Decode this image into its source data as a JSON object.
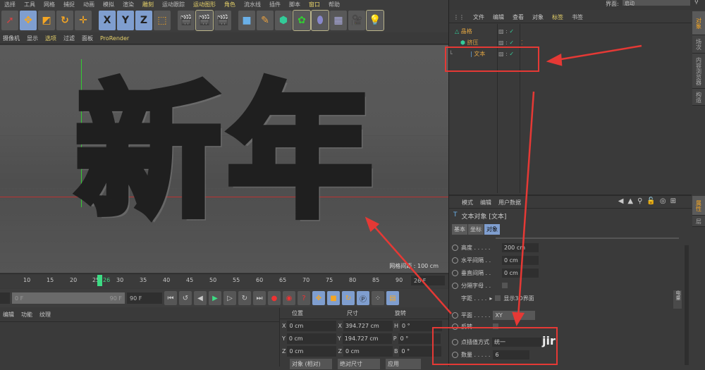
{
  "menubar": [
    "选择",
    "工具",
    "网格",
    "捕捉",
    "动画",
    "模拟",
    "渲染",
    "雕刻",
    "运动跟踪",
    "运动图形",
    "角色",
    "流水线",
    "插件",
    "脚本",
    "窗口",
    "帮助"
  ],
  "viewport_menu": [
    "摄像机",
    "显示",
    "选项",
    "过滤",
    "面板",
    "ProRender"
  ],
  "viewport": {
    "text": "新年",
    "grid_spacing": "网格间距 : 100 cm"
  },
  "timeline": {
    "ticks": [
      "10",
      "15",
      "20",
      "25",
      "26",
      "30",
      "35",
      "40",
      "45",
      "50",
      "55",
      "60",
      "65",
      "70",
      "75",
      "80",
      "85",
      "90"
    ],
    "current_frame": "26 F",
    "range_start": "0 F",
    "range_end": "90 F",
    "end_field": "90 F",
    "start_field": "0 F"
  },
  "material_menu": [
    "编辑",
    "功能",
    "纹理"
  ],
  "coordinates": {
    "headers": [
      "位置",
      "尺寸",
      "旋转"
    ],
    "rows": [
      {
        "axis": "X",
        "pos": "0 cm",
        "size": "394.727 cm",
        "rot_axis": "H",
        "rot": "0 °"
      },
      {
        "axis": "Y",
        "pos": "0 cm",
        "size": "194.727 cm",
        "rot_axis": "P",
        "rot": "0 °"
      },
      {
        "axis": "Z",
        "pos": "0 cm",
        "size": "0 cm",
        "rot_axis": "B",
        "rot": "0 °"
      }
    ],
    "buttons": [
      "对象 (相对)",
      "绝对尺寸",
      "应用"
    ]
  },
  "interface": {
    "label": "界面:",
    "value": "启动"
  },
  "object_manager": {
    "menu": [
      "文件",
      "编辑",
      "查看",
      "对象",
      "标签",
      "书签"
    ],
    "objects": [
      "晶格",
      "挤压",
      "文本"
    ]
  },
  "side_tabs_top": [
    "对象",
    "场次",
    "内容浏览器",
    "构造"
  ],
  "side_tabs_bottom": [
    "属性",
    "层"
  ],
  "attributes": {
    "menu": [
      "模式",
      "编辑",
      "用户数据"
    ],
    "title": "文本对象 [文本]",
    "tabs": [
      "基本",
      "坐标",
      "对象"
    ],
    "fields": [
      {
        "label": "高度 . . . . .",
        "value": "200 cm"
      },
      {
        "label": "水平间隔 . .",
        "value": "0 cm"
      },
      {
        "label": "垂直间隔 . .",
        "value": "0 cm"
      },
      {
        "label": "分隔字母 . ."
      }
    ],
    "kerning": "字距 . . . .",
    "show3d": "显示3D界面",
    "plane_label": "平面 . . . . .",
    "plane_value": "XY",
    "reverse_label": "反转 . . . . .",
    "interp_label": "点插值方式",
    "interp_value": "统一",
    "count_label": "数量 . . . . .",
    "count_value": "6",
    "side_label": "电量",
    "watermark": "jir"
  }
}
